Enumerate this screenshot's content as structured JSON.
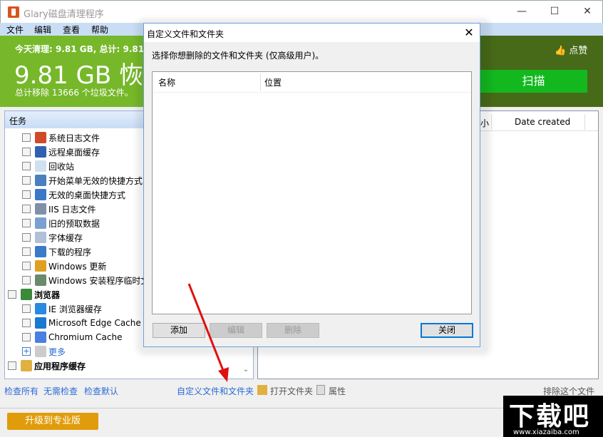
{
  "window": {
    "title": "Glary磁盘清理程序",
    "minimize": "—",
    "maximize": "☐",
    "close": "✕"
  },
  "menu": [
    "文件",
    "编辑",
    "查看",
    "帮助"
  ],
  "header": {
    "today": "今天清理: 9.81 GB, 总计: 9.81 GB",
    "big": "9.81 GB 恢复",
    "removed": "总计移除 13666 个垃圾文件。",
    "like": "点赞",
    "scan": "扫描"
  },
  "tasks": {
    "title": "任务",
    "items": [
      {
        "label": "系统日志文件",
        "icon": "log-scissors-icon",
        "color": "#d04a2a"
      },
      {
        "label": "远程桌面缓存",
        "icon": "remote-desktop-icon",
        "color": "#3060b0"
      },
      {
        "label": "回收站",
        "icon": "recycle-bin-icon",
        "color": "#cfe0ef"
      },
      {
        "label": "开始菜单无效的快捷方式",
        "icon": "start-menu-shortcut-icon",
        "color": "#4a7fc0"
      },
      {
        "label": "无效的桌面快捷方式",
        "icon": "desktop-shortcut-icon",
        "color": "#3a78c8"
      },
      {
        "label": "IIS 日志文件",
        "icon": "iis-log-icon",
        "color": "#8090a8"
      },
      {
        "label": "旧的预取数据",
        "icon": "prefetch-clock-icon",
        "color": "#7aa0d0"
      },
      {
        "label": "字体缓存",
        "icon": "font-icon",
        "color": "#b0c0d8"
      },
      {
        "label": "下载的程序",
        "icon": "download-icon",
        "color": "#3a7ac8"
      },
      {
        "label": "Windows 更新",
        "icon": "windows-update-icon",
        "color": "#e0a020"
      },
      {
        "label": "Windows 安装程序临时文件",
        "icon": "installer-icon",
        "color": "#6a8a6a"
      }
    ],
    "browsers": {
      "label": "浏览器",
      "items": [
        {
          "label": "IE 浏览器缓存",
          "icon": "ie-icon",
          "color": "#2a8ae0"
        },
        {
          "label": "Microsoft Edge Cache",
          "icon": "edge-icon",
          "color": "#1a7ad0"
        },
        {
          "label": "Chromium Cache",
          "icon": "chromium-icon",
          "color": "#4a80e0"
        }
      ],
      "more": "更多"
    },
    "appcache": "应用程序缓存"
  },
  "right": {
    "col_size": "小",
    "col_date": "Date created"
  },
  "links": {
    "check_all": "检查所有",
    "uncheck": "无需检查",
    "check_default": "检查默认",
    "custom": "自定义文件和文件夹",
    "open_folder": "打开文件夹",
    "properties": "属性",
    "exclude": "排除这个文件"
  },
  "upgrade": "升级到专业版",
  "watermark": {
    "big": "下载吧",
    "small": "www.xiazaiba.com"
  },
  "dialog": {
    "title": "自定义文件和文件夹",
    "close": "✕",
    "label": "选择你想删除的文件和文件夹 (仅高级用户)。",
    "col_name": "名称",
    "col_location": "位置",
    "add": "添加",
    "edit": "编辑",
    "delete": "删除",
    "close_btn": "关闭"
  },
  "colors": {
    "green": "#76b82a",
    "scan": "#13b81f",
    "upgrade": "#e09c0a",
    "link": "#2a6ad6",
    "arrow": "#e01010"
  }
}
